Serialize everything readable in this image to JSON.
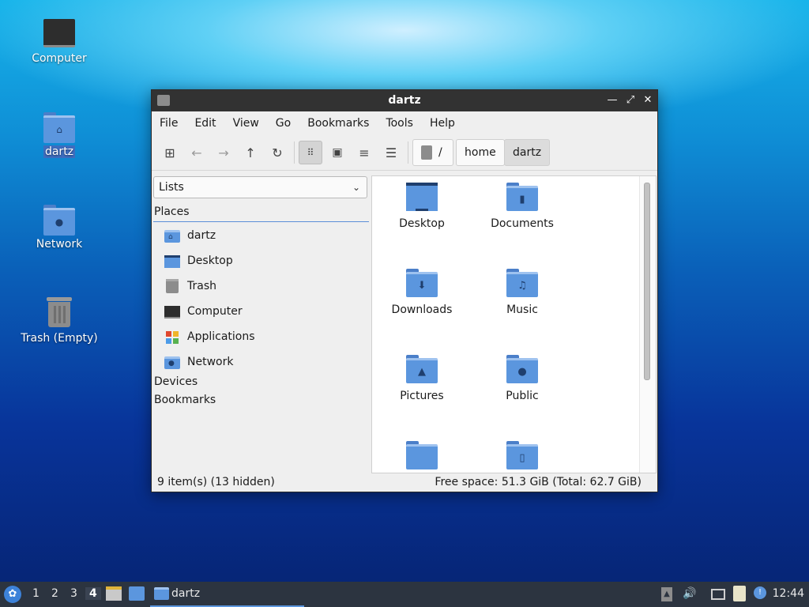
{
  "desktop": {
    "icons": [
      {
        "label": "Computer"
      },
      {
        "label": "dartz"
      },
      {
        "label": "Network"
      },
      {
        "label": "Trash (Empty)"
      }
    ]
  },
  "window": {
    "title": "dartz",
    "menu": [
      "File",
      "Edit",
      "View",
      "Go",
      "Bookmarks",
      "Tools",
      "Help"
    ],
    "path": [
      "/",
      "home",
      "dartz"
    ],
    "sidebar": {
      "combo_value": "Lists",
      "places_header": "Places",
      "places": [
        "dartz",
        "Desktop",
        "Trash",
        "Computer",
        "Applications",
        "Network"
      ],
      "devices_header": "Devices",
      "bookmarks_header": "Bookmarks"
    },
    "files": [
      "Desktop",
      "Documents",
      "Downloads",
      "Music",
      "Pictures",
      "Public",
      "",
      ""
    ],
    "status_left": "9 item(s) (13 hidden)",
    "status_right": "Free space: 51.3 GiB (Total: 62.7 GiB)"
  },
  "taskbar": {
    "workspaces": [
      "1",
      "2",
      "3",
      "4"
    ],
    "active_task": "dartz",
    "clock": "12:44"
  },
  "colors": {
    "accent": "#5b96de",
    "titlebar": "#323232",
    "taskbar": "#2c3440"
  }
}
